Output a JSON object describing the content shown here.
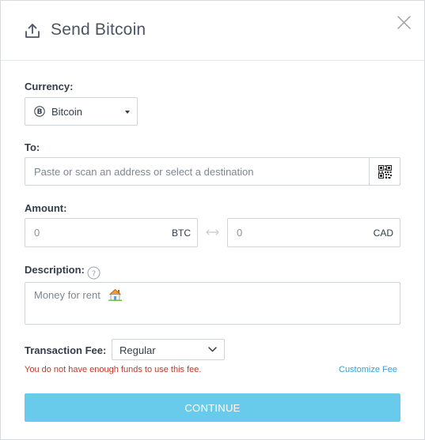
{
  "dialog": {
    "title": "Send Bitcoin"
  },
  "currency": {
    "label": "Currency:",
    "selected": "Bitcoin"
  },
  "to": {
    "label": "To:",
    "placeholder": "Paste or scan an address or select a destination"
  },
  "amount": {
    "label": "Amount:",
    "btc_placeholder": "0",
    "btc_unit": "BTC",
    "fiat_placeholder": "0",
    "fiat_unit": "CAD"
  },
  "description": {
    "label": "Description:",
    "value": "Money for rent"
  },
  "fee": {
    "label": "Transaction Fee:",
    "selected": "Regular",
    "error": "You do not have enough funds to use this fee.",
    "customize_link": "Customize Fee"
  },
  "actions": {
    "continue_label": "CONTINUE"
  },
  "colors": {
    "accent": "#68cbec",
    "link": "#2fa4d8",
    "error": "#c0392b"
  },
  "icons": {
    "header": "upload-icon",
    "close": "close-icon",
    "currency": "bitcoin-icon",
    "qr": "qr-code-icon",
    "swap": "swap-arrows-icon",
    "help": "help-icon",
    "emoji": "house-emoji-icon"
  }
}
